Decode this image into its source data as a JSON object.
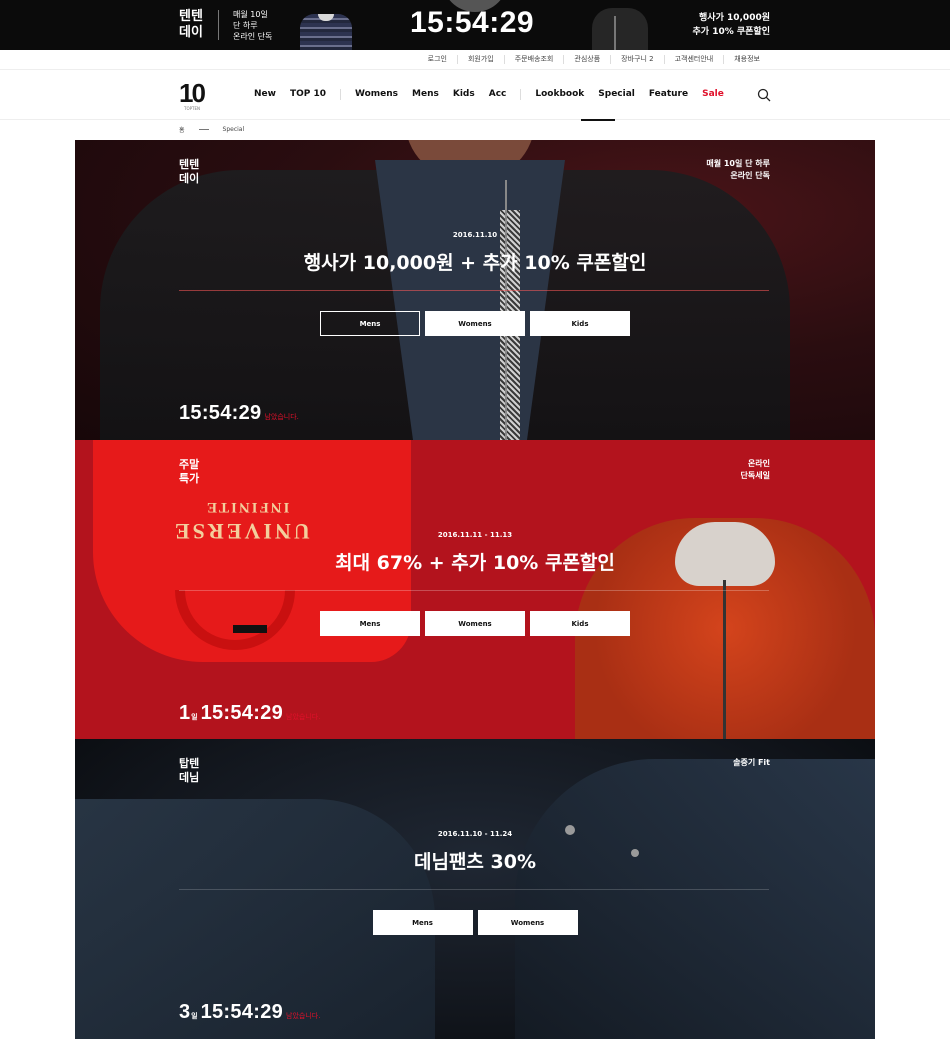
{
  "promo": {
    "brand_line1": "텐텐",
    "brand_line2": "데이",
    "desc_line1": "매월 10일",
    "desc_line2": "단 하루",
    "desc_line3": "온라인 단독",
    "clock": "15:54:29",
    "offer_line1": "행사가 10,000원",
    "offer_line2": "추가 10% 쿠폰할인"
  },
  "util_links": [
    "로그인",
    "회원가입",
    "주문배송조회",
    "관심상품",
    "장바구니  2",
    "고객센터안내",
    "채용정보"
  ],
  "header": {
    "logo_text": "10",
    "logo_sub": "TOPTEN",
    "nav_group1": [
      "New",
      "TOP 10"
    ],
    "nav_group2": [
      "Womens",
      "Mens",
      "Kids",
      "Acc"
    ],
    "nav_group3": [
      "Lookbook",
      "Special",
      "Feature"
    ],
    "nav_sale": "Sale",
    "search_icon": "search-icon"
  },
  "breadcrumb": {
    "home": "홈",
    "current": "Special"
  },
  "banners": [
    {
      "tag_line1": "텐텐",
      "tag_line2": "데이",
      "note_line1": "매월 10일 단 하루",
      "note_line2": "온라인 단독",
      "date": "2016.11.10",
      "headline": "행사가 10,000원 + 추가 10% 쿠폰할인",
      "buttons": [
        "Mens",
        "Womens",
        "Kids"
      ],
      "timer": "15:54:29",
      "remaining": "남았습니다."
    },
    {
      "tag_line1": "주말",
      "tag_line2": "특가",
      "note_line1": "온라인",
      "note_line2": "단독세일",
      "date": "2016.11.11 - 11.13",
      "headline": "최대 67% + 추가 10% 쿠폰할인",
      "buttons": [
        "Mens",
        "Womens",
        "Kids"
      ],
      "timer_days": "1",
      "day_unit": "일",
      "timer": "15:54:29",
      "remaining": "남았습니다.",
      "tee_text1": "INFINITE",
      "tee_text2": "UNIVERSE"
    },
    {
      "tag_line1": "탑텐",
      "tag_line2": "데님",
      "note_line1": "솔중기 Fit",
      "date": "2016.11.10 - 11.24",
      "headline": "데님팬츠 30%",
      "buttons": [
        "Mens",
        "Womens"
      ],
      "timer_days": "3",
      "day_unit": "일",
      "timer": "15:54:29",
      "remaining": "남았습니다."
    }
  ],
  "colors": {
    "sale_red": "#e0102a",
    "banner2_red": "#b3131d",
    "promo_black": "#0b0b0b"
  }
}
